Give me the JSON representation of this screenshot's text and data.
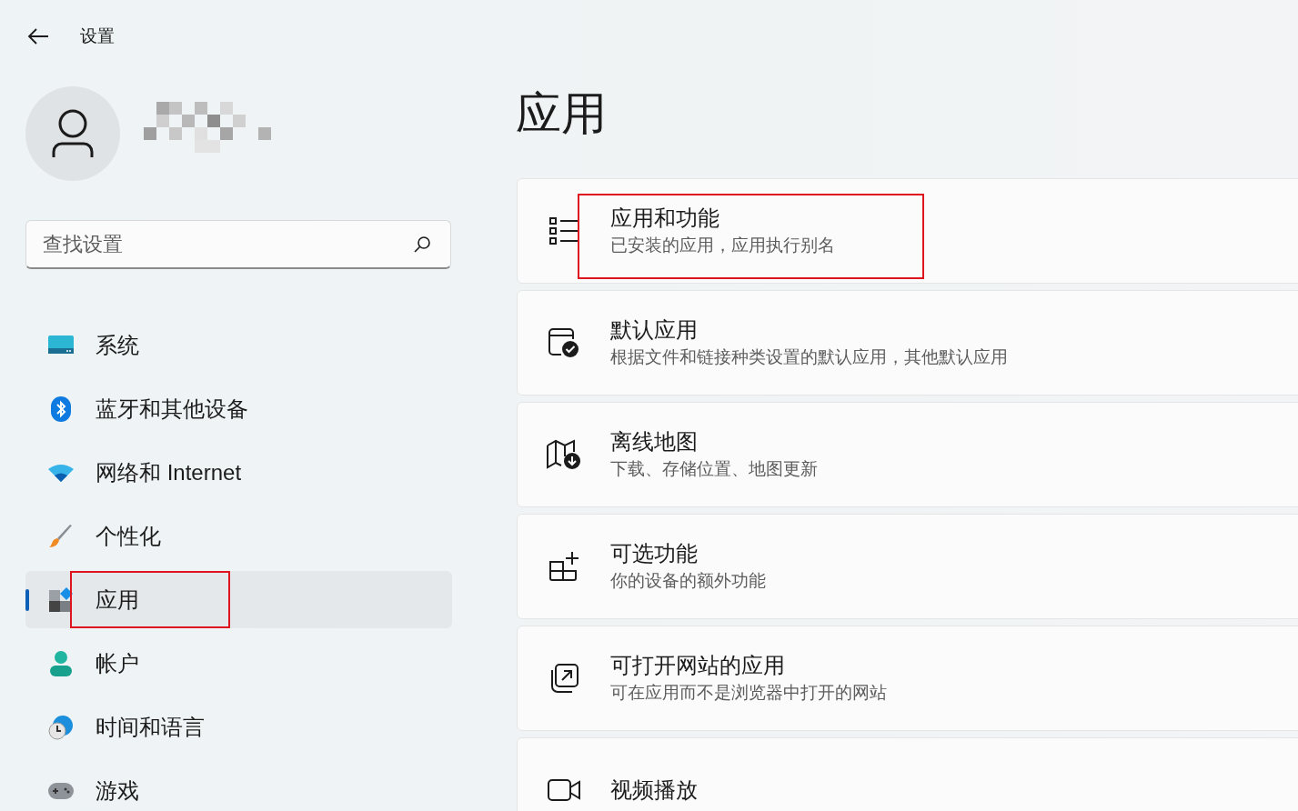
{
  "header": {
    "title": "设置"
  },
  "search": {
    "placeholder": "查找设置"
  },
  "nav": [
    {
      "label": "系统",
      "kind": "system",
      "selected": false,
      "highlighted": false
    },
    {
      "label": "蓝牙和其他设备",
      "kind": "bluetooth",
      "selected": false,
      "highlighted": false
    },
    {
      "label": "网络和 Internet",
      "kind": "network",
      "selected": false,
      "highlighted": false
    },
    {
      "label": "个性化",
      "kind": "brush",
      "selected": false,
      "highlighted": false
    },
    {
      "label": "应用",
      "kind": "apps",
      "selected": true,
      "highlighted": true
    },
    {
      "label": "帐户",
      "kind": "account",
      "selected": false,
      "highlighted": false
    },
    {
      "label": "时间和语言",
      "kind": "time",
      "selected": false,
      "highlighted": false
    },
    {
      "label": "游戏",
      "kind": "gaming",
      "selected": false,
      "highlighted": false
    }
  ],
  "page_title": "应用",
  "cards": [
    {
      "title": "应用和功能",
      "subtitle": "已安装的应用，应用执行别名",
      "kind": "list",
      "highlighted": true
    },
    {
      "title": "默认应用",
      "subtitle": "根据文件和链接种类设置的默认应用，其他默认应用",
      "kind": "default",
      "highlighted": false
    },
    {
      "title": "离线地图",
      "subtitle": "下载、存储位置、地图更新",
      "kind": "map",
      "highlighted": false
    },
    {
      "title": "可选功能",
      "subtitle": "你的设备的额外功能",
      "kind": "optional",
      "highlighted": false
    },
    {
      "title": "可打开网站的应用",
      "subtitle": "可在应用而不是浏览器中打开的网站",
      "kind": "web",
      "highlighted": false
    },
    {
      "title": "视频播放",
      "kind": "video",
      "highlighted": false
    }
  ]
}
